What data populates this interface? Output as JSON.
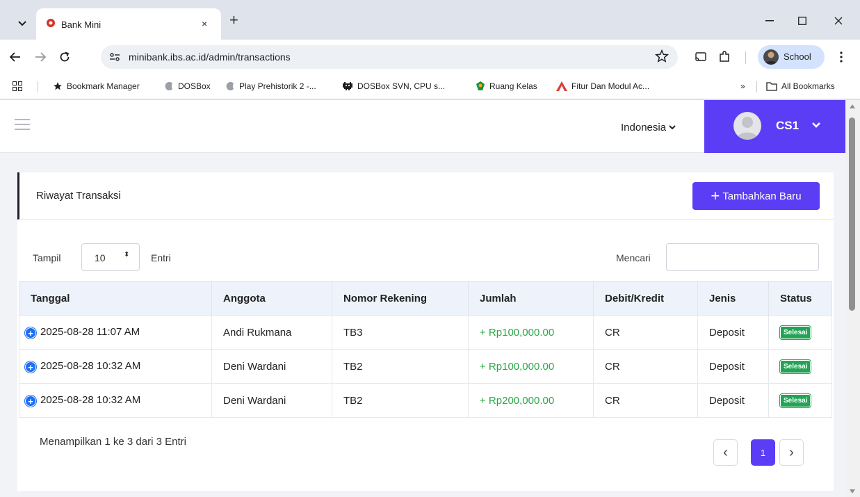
{
  "browser": {
    "tab_title": "Bank Mini",
    "tab_close": "×",
    "new_tab": "+",
    "url": "minibank.ibs.ac.id/admin/transactions",
    "profile_label": "School",
    "bookmarks": [
      {
        "label": "Bookmark Manager",
        "icon": "star-icon"
      },
      {
        "label": "DOSBox",
        "icon": "moon-icon"
      },
      {
        "label": "Play Prehistorik 2 -...",
        "icon": "moon-icon"
      },
      {
        "label": "DOSBox SVN, CPU s...",
        "icon": "invader-icon"
      },
      {
        "label": "Ruang Kelas",
        "icon": "classroom-icon"
      },
      {
        "label": "Fitur Dan Modul Ac...",
        "icon": "logo-icon"
      }
    ],
    "bookmarks_overflow": "»",
    "all_bookmarks": "All Bookmarks"
  },
  "header": {
    "language": "Indonesia",
    "user_name": "CS1",
    "accent_color": "#5b3df5"
  },
  "card": {
    "title": "Riwayat Transaksi",
    "add_button_plus": "+",
    "add_button_label": "Tambahkan Baru"
  },
  "controls": {
    "show_label": "Tampil",
    "page_size": "10",
    "page_size_caret": "⬍",
    "entries_label": "Entri",
    "search_label": "Mencari",
    "search_value": ""
  },
  "table": {
    "columns": [
      "Tanggal",
      "Anggota",
      "Nomor Rekening",
      "Jumlah",
      "Debit/Kredit",
      "Jenis",
      "Status"
    ],
    "rows": [
      {
        "expander": "+",
        "date": "2025-08-28 11:07 AM",
        "member": "Andi Rukmana",
        "account": "TB3",
        "amount": "+ Rp100,000.00",
        "dc": "CR",
        "type": "Deposit",
        "status": "Selesai"
      },
      {
        "expander": "+",
        "date": "2025-08-28 10:32 AM",
        "member": "Deni Wardani",
        "account": "TB2",
        "amount": "+ Rp100,000.00",
        "dc": "CR",
        "type": "Deposit",
        "status": "Selesai"
      },
      {
        "expander": "+",
        "date": "2025-08-28 10:32 AM",
        "member": "Deni Wardani",
        "account": "TB2",
        "amount": "+ Rp200,000.00",
        "dc": "CR",
        "type": "Deposit",
        "status": "Selesai"
      }
    ]
  },
  "footer": {
    "info": "Menampilkan 1 ke 3 dari 3 Entri",
    "prev": "‹",
    "current_page": "1",
    "next": "›"
  }
}
